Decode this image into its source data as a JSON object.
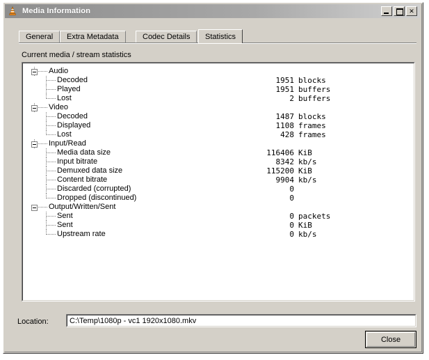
{
  "window": {
    "title": "Media Information",
    "icon": "vlc-cone-icon",
    "controls": {
      "minimize": "minimize-icon",
      "maximize": "maximize-icon",
      "close": "close-icon",
      "close_glyph": "✕"
    }
  },
  "tabs": [
    {
      "label": "General",
      "active": false
    },
    {
      "label": "Extra Metadata",
      "active": false
    },
    {
      "label": "Codec Details",
      "active": false
    },
    {
      "label": "Statistics",
      "active": true
    }
  ],
  "panel": {
    "heading": "Current media / stream statistics"
  },
  "tree": [
    {
      "level": "group",
      "label": "Audio",
      "value": "",
      "unit": ""
    },
    {
      "level": "child",
      "label": "Decoded",
      "value": "1951",
      "unit": "blocks"
    },
    {
      "level": "child",
      "label": "Played",
      "value": "1951",
      "unit": "buffers"
    },
    {
      "level": "child",
      "label": "Lost",
      "value": "2",
      "unit": "buffers",
      "last": true
    },
    {
      "level": "group",
      "label": "Video",
      "value": "",
      "unit": ""
    },
    {
      "level": "child",
      "label": "Decoded",
      "value": "1487",
      "unit": "blocks"
    },
    {
      "level": "child",
      "label": "Displayed",
      "value": "1108",
      "unit": "frames"
    },
    {
      "level": "child",
      "label": "Lost",
      "value": "428",
      "unit": "frames",
      "last": true
    },
    {
      "level": "group",
      "label": "Input/Read",
      "value": "",
      "unit": ""
    },
    {
      "level": "child",
      "label": "Media data size",
      "value": "116406",
      "unit": "KiB"
    },
    {
      "level": "child",
      "label": "Input bitrate",
      "value": "8342",
      "unit": "kb/s"
    },
    {
      "level": "child",
      "label": "Demuxed data size",
      "value": "115200",
      "unit": "KiB"
    },
    {
      "level": "child",
      "label": "Content bitrate",
      "value": "9904",
      "unit": "kb/s"
    },
    {
      "level": "child",
      "label": "Discarded (corrupted)",
      "value": "0",
      "unit": ""
    },
    {
      "level": "child",
      "label": "Dropped (discontinued)",
      "value": "0",
      "unit": "",
      "last": true
    },
    {
      "level": "group",
      "label": "Output/Written/Sent",
      "value": "",
      "unit": "",
      "lastgroup": true
    },
    {
      "level": "child",
      "label": "Sent",
      "value": "0",
      "unit": "packets"
    },
    {
      "level": "child",
      "label": "Sent",
      "value": "0",
      "unit": "KiB"
    },
    {
      "level": "child",
      "label": "Upstream rate",
      "value": "0",
      "unit": "kb/s",
      "last": true
    }
  ],
  "location": {
    "label": "Location:",
    "value": "C:\\Temp\\1080p - vc1 1920x1080.mkv"
  },
  "footer": {
    "close_label": "Close"
  },
  "colors": {
    "dialog_face": "#d4d0c8",
    "panel_bg": "#ffffff",
    "title_text": "#ffffff",
    "cone_orange": "#ef8b21"
  }
}
